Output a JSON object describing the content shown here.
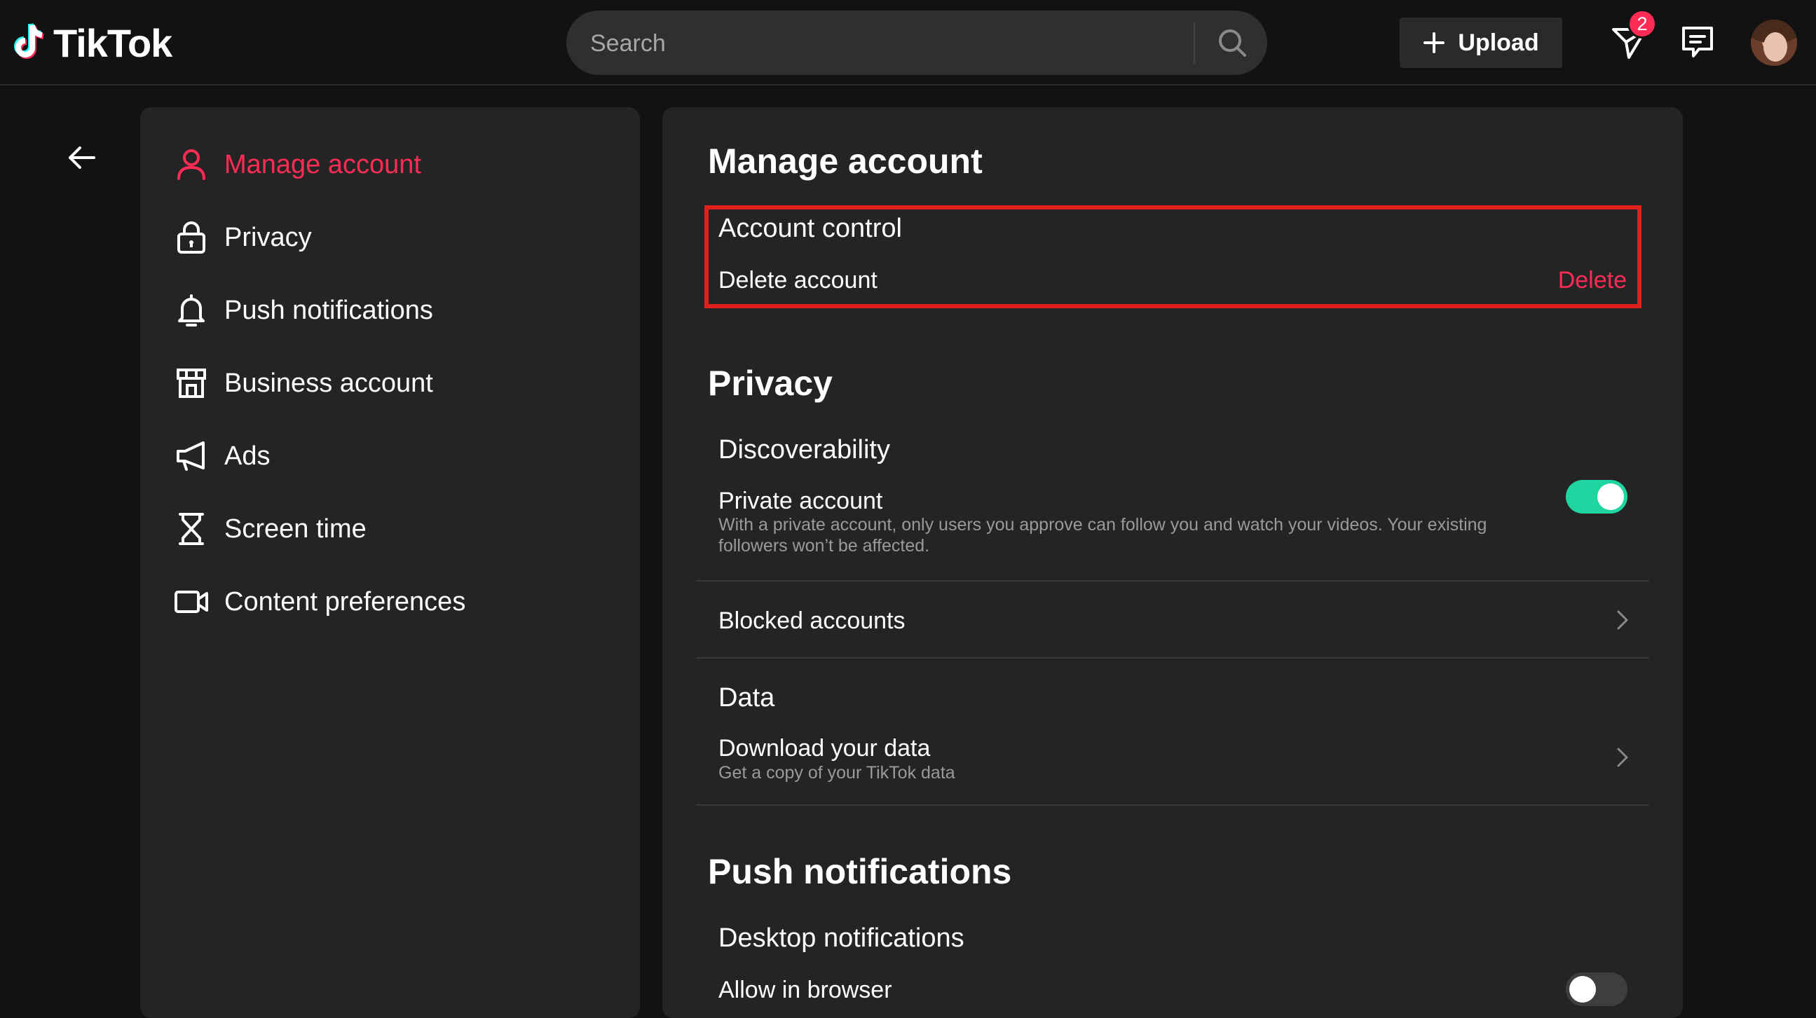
{
  "header": {
    "logo_text": "TikTok",
    "search_placeholder": "Search",
    "upload_label": "Upload",
    "inbox_badge": "2"
  },
  "sidebar": {
    "items": [
      {
        "label": "Manage account",
        "icon": "person-icon",
        "active": true
      },
      {
        "label": "Privacy",
        "icon": "lock-icon"
      },
      {
        "label": "Push notifications",
        "icon": "bell-icon"
      },
      {
        "label": "Business account",
        "icon": "store-icon"
      },
      {
        "label": "Ads",
        "icon": "megaphone-icon"
      },
      {
        "label": "Screen time",
        "icon": "hourglass-icon"
      },
      {
        "label": "Content preferences",
        "icon": "video-camera-icon"
      }
    ]
  },
  "main": {
    "manage_account": {
      "title": "Manage account",
      "account_control": "Account control",
      "delete_account": "Delete account",
      "delete_link": "Delete"
    },
    "privacy": {
      "title": "Privacy",
      "discoverability": "Discoverability",
      "private_account": "Private account",
      "private_account_desc_line1": "With a private account, only users you approve can follow you and watch your videos. Your existing",
      "private_account_desc_line2": "followers won’t be affected.",
      "private_account_enabled": true,
      "blocked_accounts": "Blocked accounts",
      "data": "Data",
      "download_data": "Download your data",
      "download_data_desc": "Get a copy of your TikTok data"
    },
    "push_notifications": {
      "title": "Push notifications",
      "desktop_notifications": "Desktop notifications",
      "allow_in_browser": "Allow in browser",
      "allow_in_browser_enabled": false
    }
  },
  "colors": {
    "accent": "#fe2c55",
    "toggle_on": "#20d5a0",
    "highlight": "#e1201b"
  }
}
